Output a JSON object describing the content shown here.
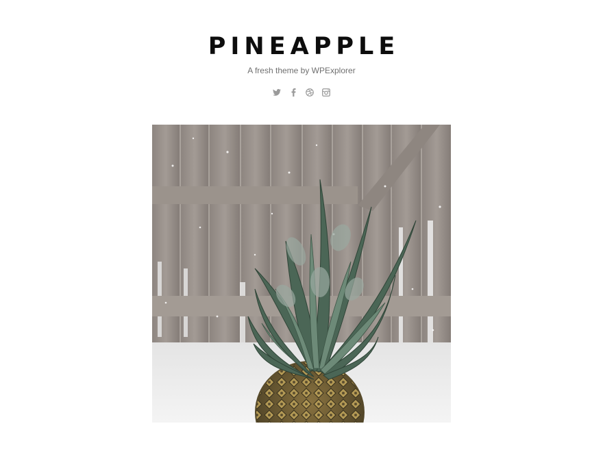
{
  "site": {
    "title": "PINEAPPLE",
    "description": "A fresh theme by WPExplorer"
  },
  "social": [
    {
      "name": "twitter",
      "icon": "twitter-icon"
    },
    {
      "name": "facebook",
      "icon": "facebook-icon"
    },
    {
      "name": "dribbble",
      "icon": "dribbble-icon"
    },
    {
      "name": "instagram",
      "icon": "instagram-icon"
    }
  ],
  "colors": {
    "title": "#0d0d0d",
    "tagline": "#6f6f6f",
    "icon": "#9a9a9a",
    "background": "#ffffff"
  },
  "featured": {
    "subject": "pineapple-photo"
  }
}
